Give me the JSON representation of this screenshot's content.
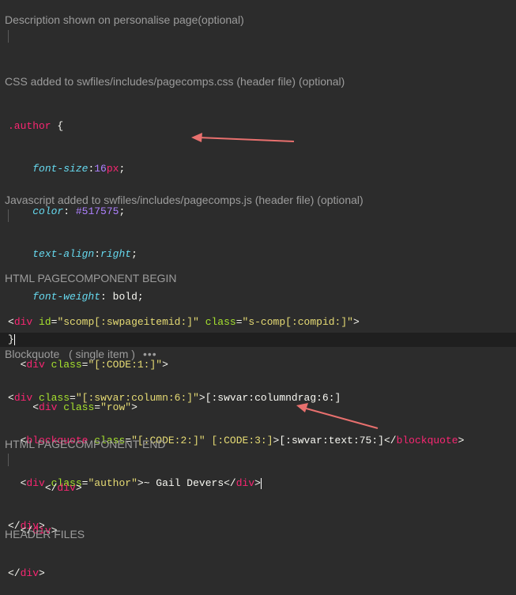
{
  "sections": {
    "description_label": "Description shown on personalise page(optional)",
    "css_label": "CSS added to swfiles/includes/pagecomps.css (header file) (optional)",
    "js_label": "Javascript added to swfiles/includes/pagecomps.js (header file) (optional)",
    "html_begin_label": "HTML PAGECOMPONENT BEGIN",
    "blockquote_label": "Blockquote",
    "blockquote_sub": "( single item )",
    "blockquote_menu": "•••",
    "html_end_label": "HTML PAGECOMPONENT END",
    "header_files_label": "HEADER FILES"
  },
  "css_code": {
    "selector": ".author",
    "open": " {",
    "p1": "font-size",
    "v1_num": "16",
    "v1_unit": "px",
    "p2": "color",
    "v2": " #517575",
    "p3": "text-align",
    "v3": "right",
    "p4": "font-weight",
    "v4": " bold",
    "close": "}"
  },
  "html_begin_code": {
    "l1_tag": "div",
    "l1_attr1": "id",
    "l1_val1": "\"scomp[:swpageitemid:]\"",
    "l1_attr2": "class",
    "l1_val2": "\"s-comp[:compid:]\"",
    "l2_tag": "div",
    "l2_attr": "class",
    "l2_val": "\"[:CODE:1:]\"",
    "l3_tag": "div",
    "l3_attr": "class",
    "l3_val": "\"row\""
  },
  "blockquote_code": {
    "l1_tag": "div",
    "l1_attr": "class",
    "l1_val": "\"[:swvar:column:6:]\"",
    "l1_text": "[:swvar:columndrag:6:]",
    "l2_tag": "blockquote",
    "l2_attr": "class",
    "l2_val": "\"[:CODE:2:]\"",
    "l2_val2": "[:CODE:3:]",
    "l2_text": "[:swvar:text:75:]",
    "l3_tag": "div",
    "l3_attr": "class",
    "l3_val": "\"author\"",
    "l3_text": "~ Gail Devers",
    "l4_tag": "div"
  },
  "html_end_code": {
    "tag": "div"
  },
  "annotation": {
    "arrow_color": "#e8706e"
  }
}
